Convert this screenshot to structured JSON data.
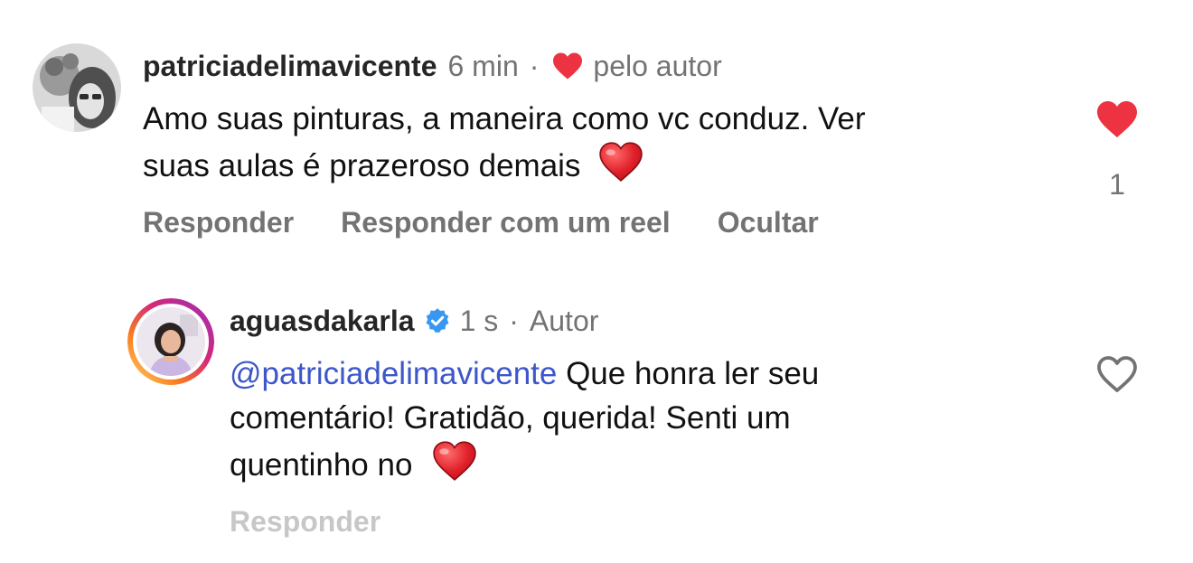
{
  "comment": {
    "username": "patriciadelimavicente",
    "time": "6 min",
    "separator": "·",
    "liked_by_author": "pelo autor",
    "text_line1": "Amo suas pinturas, a maneira como vc conduz. Ver",
    "text_line2": "suas aulas é prazeroso demais",
    "actions": {
      "reply": "Responder",
      "reply_reel": "Responder com um reel",
      "hide": "Ocultar"
    },
    "like_count": "1",
    "liked": true,
    "icons": {
      "avatar": "avatar-photo",
      "inline_heart": "red-heart-emoji",
      "author_heart": "filled-heart-icon",
      "like": "filled-heart-icon"
    }
  },
  "reply": {
    "username": "aguasdakarla",
    "time": "1 s",
    "separator": "·",
    "badge_label": "Autor",
    "mention": "@patriciadelimavicente",
    "text_line1_rest": " Que honra ler seu",
    "text_line2": "comentário! Gratidão, querida! Senti um",
    "text_line3": "quentinho no",
    "actions": {
      "reply": "Responder"
    },
    "liked": false,
    "icons": {
      "avatar": "avatar-story-ring",
      "verified": "verified-badge-icon",
      "inline_heart": "red-heart-emoji",
      "like": "heart-outline-icon"
    }
  },
  "colors": {
    "like_red": "#ed3241",
    "mention_blue": "#3d57c9",
    "verified_blue": "#3897f0",
    "muted_gray": "#737373"
  }
}
